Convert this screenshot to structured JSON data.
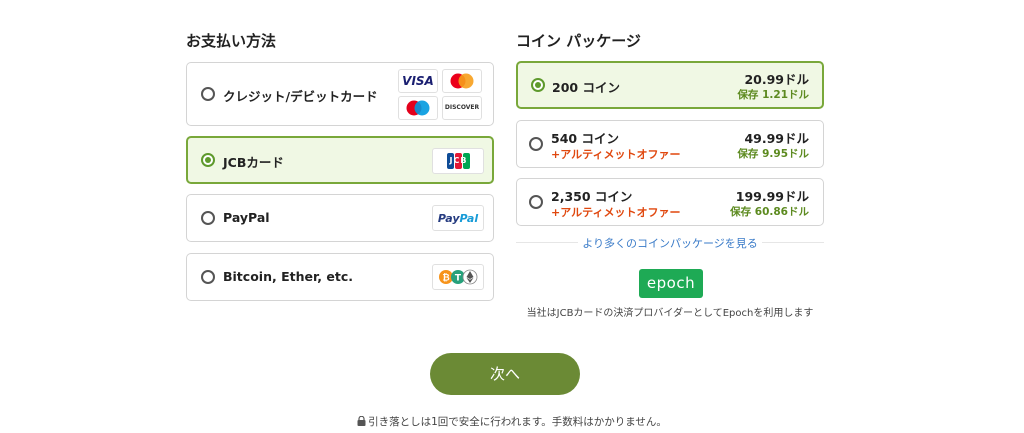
{
  "payment": {
    "title": "お支払い方法",
    "methods": [
      {
        "label": "クレジット/デビットカード",
        "selected": false,
        "icons": [
          "visa-icon",
          "mastercard-icon",
          "maestro-icon",
          "discover-icon"
        ]
      },
      {
        "label": "JCBカード",
        "selected": true,
        "icons": [
          "jcb-icon"
        ]
      },
      {
        "label": "PayPal",
        "selected": false,
        "icons": [
          "paypal-icon"
        ]
      },
      {
        "label": "Bitcoin, Ether, etc.",
        "selected": false,
        "icons": [
          "bitcoin-icon",
          "tether-icon",
          "ethereum-icon"
        ]
      }
    ],
    "logo_text": {
      "visa": "VISA",
      "discover": "DISCOVER",
      "jcb": "JCB",
      "paypal_a": "Pay",
      "paypal_b": "Pal"
    }
  },
  "coins": {
    "title": "コイン パッケージ",
    "packages": [
      {
        "name": "200 コイン",
        "offer": "",
        "price": "20.99ドル",
        "save": "保存 1.21ドル",
        "selected": true
      },
      {
        "name": "540 コイン",
        "offer": "+アルティメットオファー",
        "price": "49.99ドル",
        "save": "保存 9.95ドル",
        "selected": false
      },
      {
        "name": "2,350 コイン",
        "offer": "+アルティメットオファー",
        "price": "199.99ドル",
        "save": "保存 60.86ドル",
        "selected": false
      }
    ],
    "more_link": "より多くのコインパッケージを見る",
    "epoch_logo": "epoch",
    "provider_text": "当社はJCBカードの決済プロバイダーとしてEpochを利用します"
  },
  "next_button": "次へ",
  "footer_note": "引き落としは1回で安全に行われます。手数料はかかりません。",
  "colors": {
    "accent": "#6b8a35",
    "selected_border": "#79a83a",
    "selected_bg": "#f0f8e4",
    "offer": "#e0480f",
    "save": "#5c8a1f",
    "link": "#3a7bc8"
  }
}
